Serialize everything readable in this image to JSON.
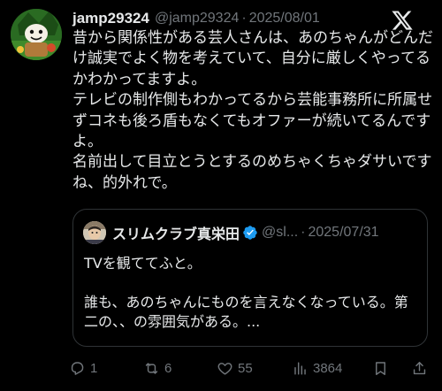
{
  "tweet": {
    "author": {
      "display_name": "jamp29324",
      "handle": "@jamp29324",
      "separator": "·",
      "date": "2025/08/01",
      "avatar_icon": "green-cartoon-avatar"
    },
    "body_paragraphs": [
      "昔から関係性がある芸人さんは、あのちゃんがどんだけ誠実でよく物を考えていて、自分に厳しくやってるかわかってますよ。",
      "テレビの制作側もわかってるから芸能事務所に所属せずコネも後ろ盾もなくてもオファーが続いてるんですよ。",
      "名前出して目立とうとするのめちゃくちゃダサいですね、的外れで。"
    ],
    "quote": {
      "display_name": "スリムクラブ真栄田",
      "verified_icon": "verified-badge-icon",
      "handle": "@sl...",
      "separator": "·",
      "date": "2025/07/31",
      "text_paragraphs": [
        "TVを観ててふと。",
        "",
        "誰も、あのちゃんにものを言えなくなっている。第二の、、の雰囲気がある。..."
      ]
    },
    "actions": {
      "reply_count": "1",
      "retweet_count": "6",
      "like_count": "55",
      "view_count": "3864"
    }
  },
  "colors": {
    "background": "#000000",
    "text_primary": "#e7e9ea",
    "text_secondary": "#71767b",
    "border": "#2f3336",
    "verified_blue": "#1d9bf0"
  }
}
